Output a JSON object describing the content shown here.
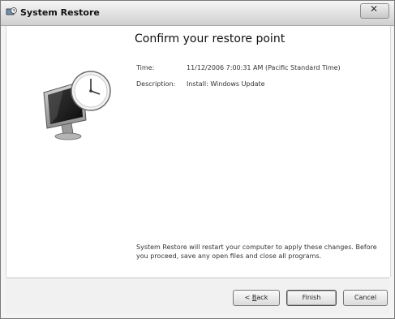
{
  "window": {
    "title": "System Restore"
  },
  "main": {
    "heading": "Confirm your restore point",
    "fields": {
      "time_label": "Time:",
      "time_value": "11/12/2006 7:00:31 AM (Pacific Standard Time)",
      "description_label": "Description:",
      "description_value": "Install: Windows Update"
    },
    "footnote": "System Restore will restart your computer to apply these changes. Before you proceed, save any open files and close all programs."
  },
  "buttons": {
    "back_prefix": "< ",
    "back_mnemonic": "B",
    "back_rest": "ack",
    "finish": "Finish",
    "cancel": "Cancel"
  },
  "icons": {
    "title_icon": "system-restore-icon",
    "illustration": "monitor-clock-icon"
  }
}
